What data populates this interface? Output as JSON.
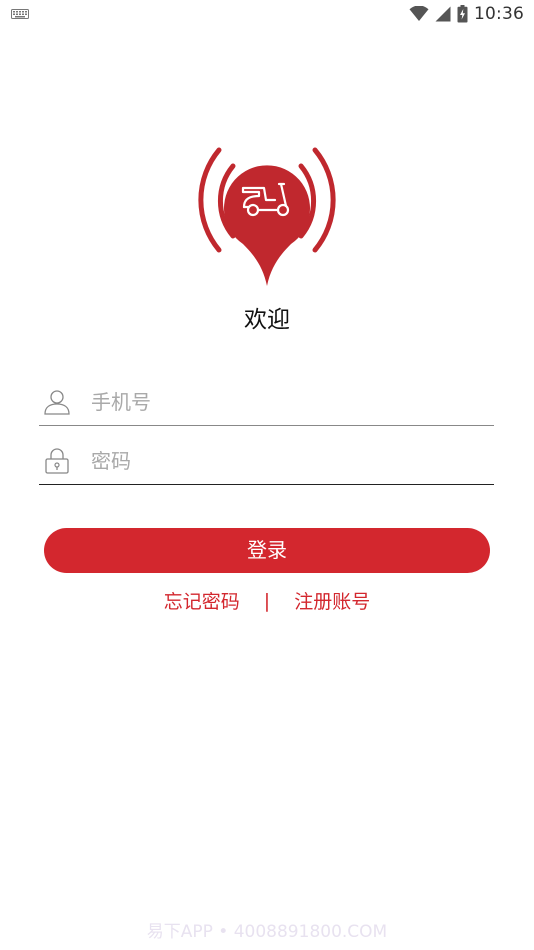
{
  "status_bar": {
    "time": "10:36",
    "icons": [
      "keyboard-icon",
      "wifi-icon",
      "signal-icon",
      "battery-charging-icon"
    ]
  },
  "logo": {
    "icon": "scooter-location-pin-icon",
    "brand_color": "#c0282e"
  },
  "welcome_text": "欢迎",
  "form": {
    "phone": {
      "icon": "user-icon",
      "placeholder": "手机号",
      "value": ""
    },
    "password": {
      "icon": "lock-icon",
      "placeholder": "密码",
      "value": ""
    },
    "login_label": "登录"
  },
  "links": {
    "forgot_password": "忘记密码",
    "separator": "|",
    "register": "注册账号"
  },
  "watermark": "易下APP • 4008891800.COM",
  "colors": {
    "accent": "#d3272e",
    "placeholder": "#a9a9a9"
  }
}
